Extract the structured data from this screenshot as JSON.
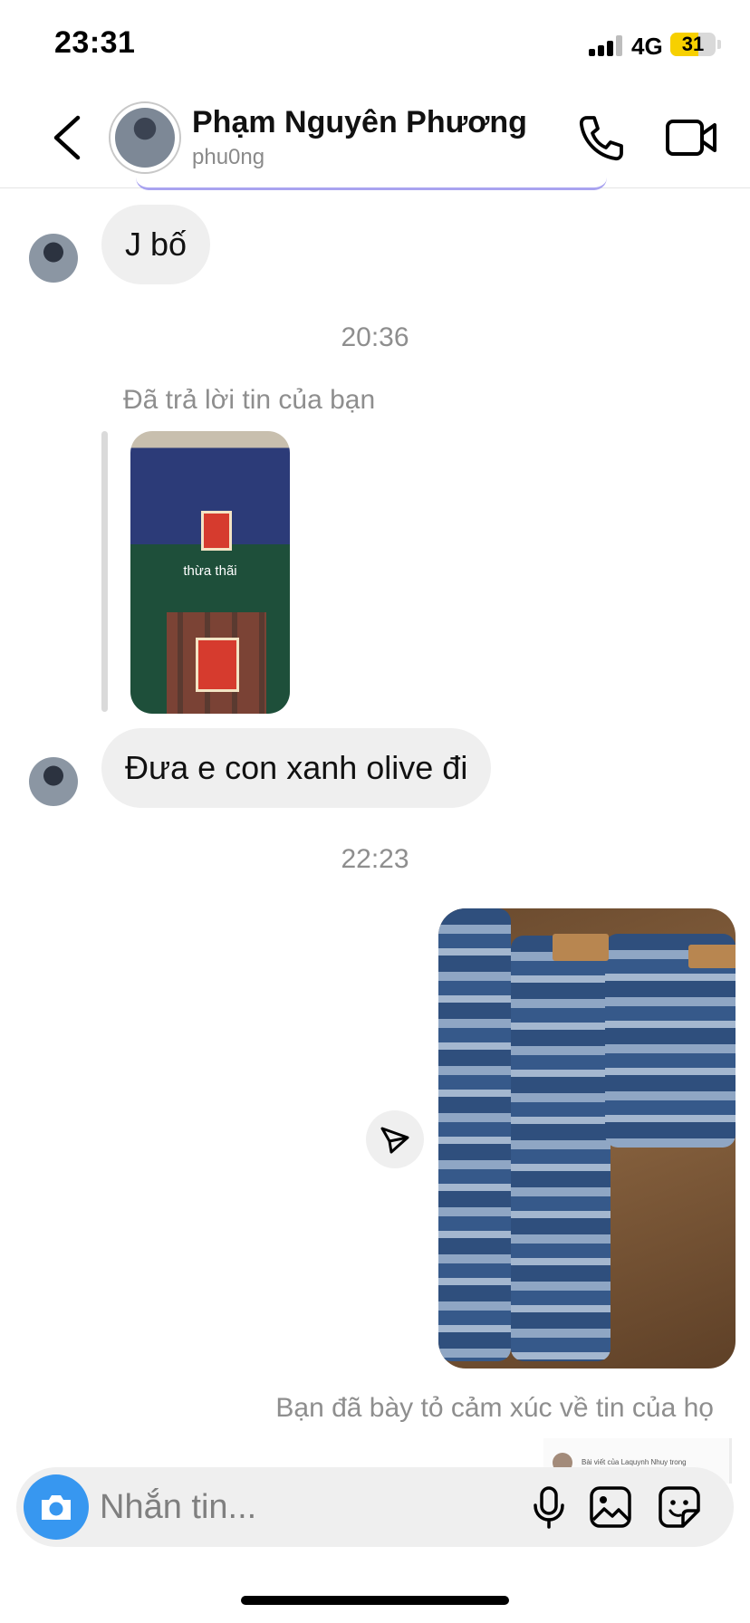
{
  "status_bar": {
    "time": "23:31",
    "network": "4G",
    "battery": "31"
  },
  "header": {
    "name": "Phạm Nguyên Phương",
    "handle": "phu0ng"
  },
  "messages": {
    "m1": "J bố",
    "ts1": "20:36",
    "reply_label": "Đã trả lời tin của bạn",
    "reply_photo_caption": "thừa thãi",
    "m2": "Đưa e con xanh olive đi",
    "ts2": "22:23",
    "reaction_note": "Bạn đã bày tỏ cảm xúc về tin của họ",
    "peek_caption": "Bài viết của Laquynh Nhuy trong"
  },
  "composer": {
    "placeholder": "Nhắn tin..."
  },
  "colors": {
    "accent": "#3797f0",
    "bubble": "#efefef",
    "muted": "#8e8e8e"
  }
}
